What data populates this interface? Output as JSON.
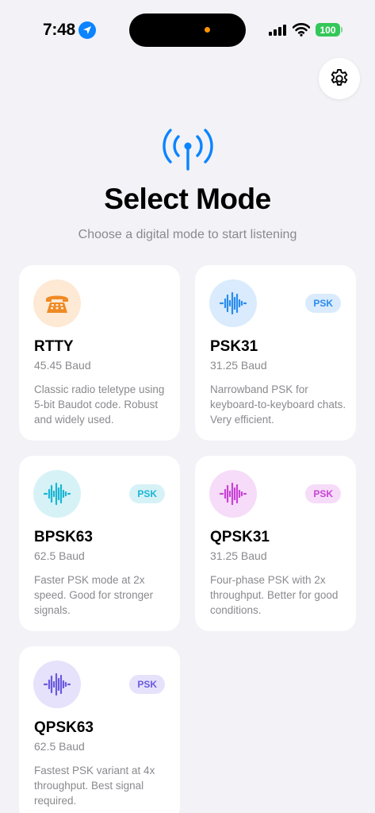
{
  "status_bar": {
    "time": "7:48",
    "battery": "100"
  },
  "header": {
    "title": "Select Mode",
    "subtitle": "Choose a digital mode to start listening"
  },
  "modes": [
    {
      "name": "RTTY",
      "baud": "45.45 Baud",
      "description": "Classic radio teletype using 5-bit Baudot code. Robust and widely used.",
      "badge": "",
      "icon": "telephone-icon",
      "accent": "#f08a24",
      "icon_bg": "#fde9d4"
    },
    {
      "name": "PSK31",
      "baud": "31.25 Baud",
      "description": "Narrowband PSK for keyboard-to-keyboard chats. Very efficient.",
      "badge": "PSK",
      "icon": "waveform-icon",
      "accent": "#2a8cf0",
      "icon_bg": "#d9ebfc"
    },
    {
      "name": "BPSK63",
      "baud": "62.5 Baud",
      "description": "Faster PSK mode at 2x speed. Good for stronger signals.",
      "badge": "PSK",
      "icon": "waveform-icon",
      "accent": "#1cb6d4",
      "icon_bg": "#d6f2f7"
    },
    {
      "name": "QPSK31",
      "baud": "31.25 Baud",
      "description": "Four-phase PSK with 2x throughput. Better for good conditions.",
      "badge": "PSK",
      "icon": "waveform-icon",
      "accent": "#c843d6",
      "icon_bg": "#f6dcf8"
    },
    {
      "name": "QPSK63",
      "baud": "62.5 Baud",
      "description": "Fastest PSK variant at 4x throughput. Best signal required.",
      "badge": "PSK",
      "icon": "waveform-icon",
      "accent": "#6a5ae0",
      "icon_bg": "#e6e2fb"
    }
  ],
  "colors": {
    "background": "#f2f2f7",
    "accent_blue": "#0a84ff",
    "battery_green": "#34c759"
  }
}
